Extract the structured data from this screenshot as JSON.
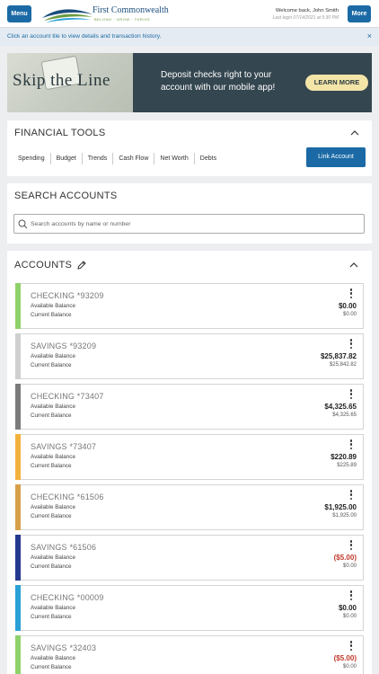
{
  "header": {
    "menu_label": "Menu",
    "more_label": "More",
    "bank_name": "First Commonwealth",
    "tagline": "BELONG · GROW · THRIVE",
    "welcome": "Welcome back, John Smith",
    "last_login": "Last login 07/14/2021 at 5:30 PM"
  },
  "info_bar": {
    "text": "Click an account tile to view details and transaction history.",
    "close_symbol": "×"
  },
  "banner": {
    "headline": "Skip the Line",
    "text": "Deposit checks right to your account with our mobile app!",
    "button_label": "LEARN MORE"
  },
  "financial_tools": {
    "title": "FINANCIAL TOOLS",
    "tabs": [
      "Spending",
      "Budget",
      "Trends",
      "Cash Flow",
      "Net Worth",
      "Debts"
    ],
    "link_button": "Link Account"
  },
  "search": {
    "title": "SEARCH ACCOUNTS",
    "placeholder": "Search accounts by name or number"
  },
  "accounts": {
    "title": "ACCOUNTS",
    "available_label": "Available Balance",
    "current_label": "Current Balance",
    "items": [
      {
        "name": "CHECKING *93209",
        "available": "$0.00",
        "current": "$0.00",
        "color": "#8fd16a",
        "negative": false
      },
      {
        "name": "SAVINGS *93209",
        "available": "$25,837.82",
        "current": "$25,842.82",
        "color": "#cfcfcf",
        "negative": false
      },
      {
        "name": "CHECKING *73407",
        "available": "$4,325.65",
        "current": "$4,325.65",
        "color": "#7b7b7b",
        "negative": false
      },
      {
        "name": "SAVINGS *73407",
        "available": "$220.89",
        "current": "$225.89",
        "color": "#f2b13c",
        "negative": false
      },
      {
        "name": "CHECKING *61506",
        "available": "$1,925.00",
        "current": "$1,925.00",
        "color": "#d9a04a",
        "negative": false
      },
      {
        "name": "SAVINGS *61506",
        "available": "($5.00)",
        "current": "$0.00",
        "color": "#24388e",
        "negative": true
      },
      {
        "name": "CHECKING *00009",
        "available": "$0.00",
        "current": "$0.00",
        "color": "#2ba0d6",
        "negative": false
      },
      {
        "name": "SAVINGS *32403",
        "available": "($5.00)",
        "current": "$0.00",
        "color": "#8fd16a",
        "negative": true
      }
    ]
  },
  "colors": {
    "primary_blue": "#1b6aa5",
    "negative_red": "#c0392b",
    "banner_bg": "#34464f",
    "banner_button": "#f3e4a8"
  }
}
